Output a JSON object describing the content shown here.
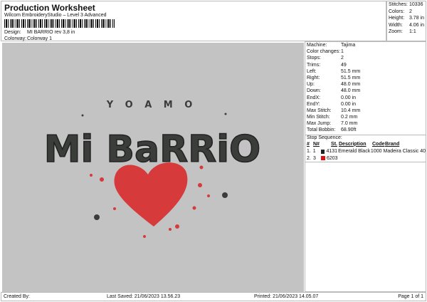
{
  "header": {
    "title": "Production Worksheet",
    "subtitle": "Wilcom EmbroideryStudio – Level 3 Advanced",
    "design_label": "Design:",
    "design_value": "MI BARRIO rev 3,8 in",
    "colorway_label": "Colorway:",
    "colorway_value": "Colorway 1"
  },
  "stats": [
    {
      "k": "Stitches:",
      "v": "10336"
    },
    {
      "k": "Colors:",
      "v": "2"
    },
    {
      "k": "Height:",
      "v": "3.78 in"
    },
    {
      "k": "Width:",
      "v": "4.06 in"
    },
    {
      "k": "Zoom:",
      "v": "1:1"
    }
  ],
  "design_art": {
    "line1": "Y O  A M O",
    "line2": "Mi BaRRiO",
    "colors": {
      "background": "#c3c3c3",
      "thread1": "#3a3d3a",
      "thread2": "#d63a3a"
    }
  },
  "details": [
    {
      "k": "Machine:",
      "v": "Tajima"
    },
    {
      "k": "Color changes:",
      "v": "1"
    },
    {
      "k": "Stops:",
      "v": "2"
    },
    {
      "k": "Trims:",
      "v": "49"
    },
    {
      "k": "Left:",
      "v": "51.5 mm"
    },
    {
      "k": "Right:",
      "v": "51.5 mm"
    },
    {
      "k": "Up:",
      "v": "48.0 mm"
    },
    {
      "k": "Down:",
      "v": "48.0 mm"
    },
    {
      "k": "EndX:",
      "v": "0.00 in"
    },
    {
      "k": "EndY:",
      "v": "0.00 in"
    },
    {
      "k": "Max Stitch:",
      "v": "10.4 mm"
    },
    {
      "k": "Min Stitch:",
      "v": "0.2 mm"
    },
    {
      "k": "Max Jump:",
      "v": "7.0 mm"
    },
    {
      "k": "Total Bobbin:",
      "v": "68.90ft"
    }
  ],
  "stop_sequence": {
    "label": "Stop Sequence:",
    "headers": [
      "#",
      "N#",
      "St.",
      "Description",
      "Code",
      "Brand"
    ],
    "rows": [
      {
        "num": "1.",
        "n": "1",
        "color": "#222222",
        "st": "4131",
        "desc": "Emerald Black",
        "code": "1000",
        "brand": "Madeira Classic 40"
      },
      {
        "num": "2.",
        "n": "3",
        "color": "#e01010",
        "st": "6203",
        "desc": "",
        "code": "",
        "brand": ""
      }
    ]
  },
  "footer": {
    "created": "Created By:",
    "saved": "Last Saved: 21/06/2023 13.56.23",
    "printed": "Printed: 21/06/2023 14.05.07",
    "page": "Page 1 of 1"
  }
}
